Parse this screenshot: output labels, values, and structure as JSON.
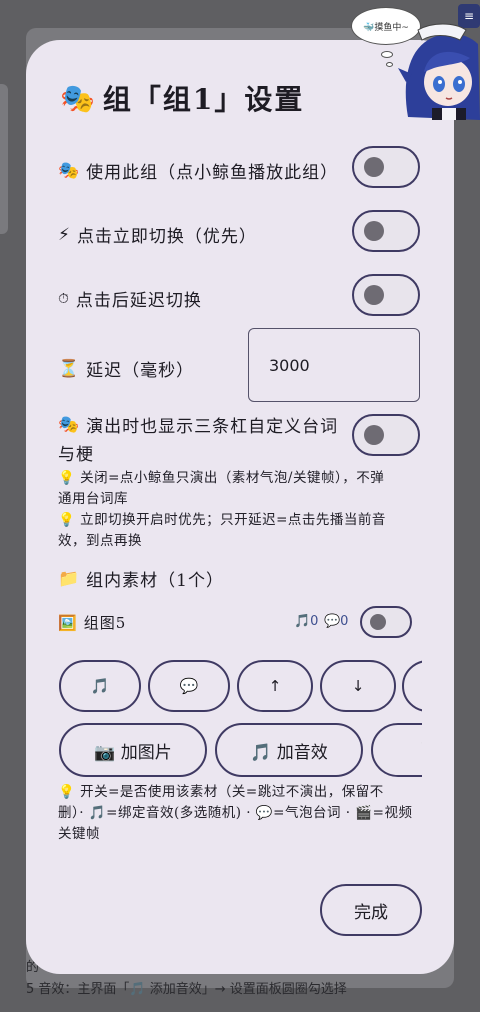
{
  "background": {
    "menu_icon": "≡",
    "text_line1": "的",
    "text_line2": "5 音效：主界面「🎵 添加音效」→ 设置面板圆圈勾选择"
  },
  "mascot": {
    "bubble_text": "🐳摸鱼中~"
  },
  "modal": {
    "title_emoji": "🎭",
    "title": "组「组1」设置",
    "use_group": {
      "emoji": "🎭",
      "label": "使用此组（点小鲸鱼播放此组）",
      "on": false
    },
    "instant_switch": {
      "emoji": "⚡",
      "label": "点击立即切换（优先）",
      "on": false
    },
    "delay_switch": {
      "emoji": "⏱",
      "label": "点击后延迟切换",
      "on": false
    },
    "delay": {
      "emoji": "⏳",
      "label": "延迟（毫秒）",
      "value": "3000"
    },
    "show_bars": {
      "emoji": "🎭",
      "label_line1": "演出时也显示三条杠自定义台词",
      "label_line2": "与梗",
      "on": false
    },
    "hint1_line1": "💡 关闭=点小鲸鱼只演出（素材气泡/关键帧），不弹",
    "hint1_line2": "通用台词库",
    "hint2_line1": "💡 立即切换开启时优先；只开延迟=点击先播当前音",
    "hint2_line2": "效，到点再换",
    "assets_heading": {
      "emoji": "📁",
      "label": "组内素材（1个）"
    },
    "asset": {
      "emoji": "🖼️",
      "name": "组图5",
      "sound_count": "🎵0",
      "bubble_count": "💬0",
      "on": false
    },
    "action_pills": [
      "🎵",
      "💬",
      "↑",
      "↓",
      ""
    ],
    "add_image": "📷 加图片",
    "add_sound": "🎵 加音效",
    "add_keyframe": "🎬",
    "hint3_line1": "💡 开关=是否使用该素材（关=跳过不演出，保留不",
    "hint3_line2": "删）· 🎵=绑定音效(多选随机) · 💬=气泡台词 · 🎬=视频",
    "hint3_line3": "关键帧",
    "done": "完成"
  }
}
